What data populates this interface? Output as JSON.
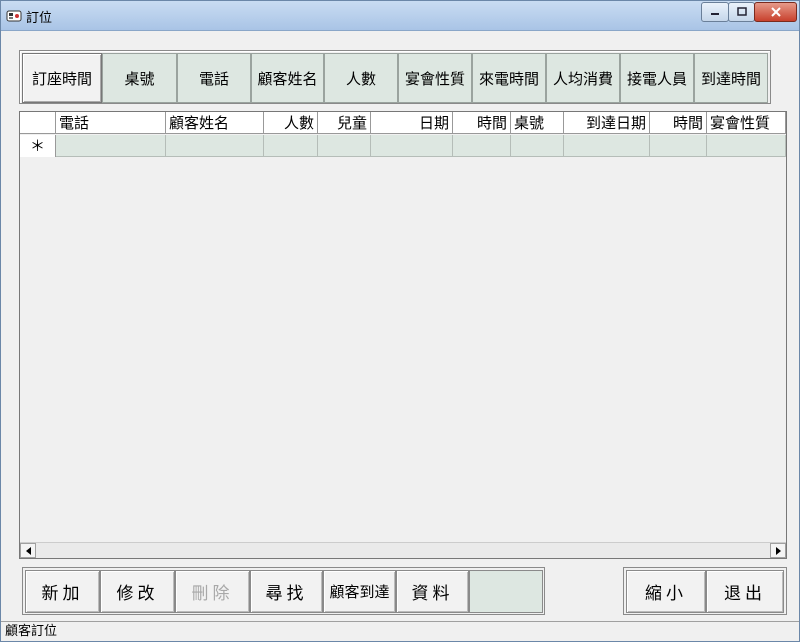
{
  "window": {
    "title": "訂位",
    "icon": "phone-app-icon"
  },
  "tabs": [
    {
      "label": "訂座時間",
      "active": true
    },
    {
      "label": "桌號"
    },
    {
      "label": "電話"
    },
    {
      "label": "顧客姓名"
    },
    {
      "label": "人數"
    },
    {
      "label": "宴會性質"
    },
    {
      "label": "來電時間"
    },
    {
      "label": "人均消費"
    },
    {
      "label": "接電人員"
    },
    {
      "label": "到達時間"
    }
  ],
  "grid": {
    "columns": [
      "電話",
      "顧客姓名",
      "人數",
      "兒童",
      "日期",
      "時間",
      "桌號",
      "到達日期",
      "時間",
      "宴會性質"
    ],
    "new_row_marker": "＊"
  },
  "buttons": {
    "add": "新加",
    "edit": "修改",
    "delete": "刪除",
    "search": "尋找",
    "customer_arrive": "顧客到達",
    "data": "資料",
    "minimize": "縮小",
    "exit": "退出"
  },
  "status": {
    "text": "顧客訂位"
  }
}
